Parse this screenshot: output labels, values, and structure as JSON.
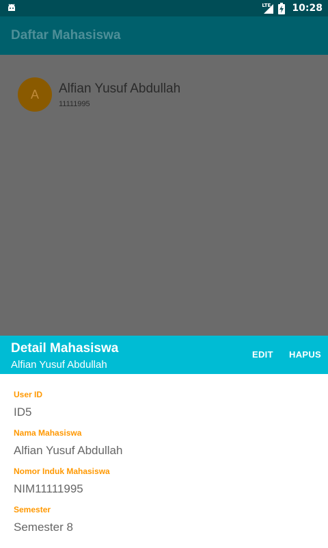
{
  "status_bar": {
    "network": "LTE",
    "time": "10:28"
  },
  "toolbar": {
    "title": "Daftar Mahasiswa"
  },
  "list": {
    "items": [
      {
        "avatar_letter": "A",
        "name": "Alfian Yusuf Abdullah",
        "nim": "11111995"
      }
    ]
  },
  "detail_sheet": {
    "title": "Detail Mahasiswa",
    "subtitle": "Alfian Yusuf Abdullah",
    "edit_label": "EDIT",
    "delete_label": "HAPUS",
    "fields": [
      {
        "label": "User ID",
        "value": "ID5"
      },
      {
        "label": "Nama Mahasiswa",
        "value": "Alfian Yusuf Abdullah"
      },
      {
        "label": "Nomor Induk Mahasiswa",
        "value": "NIM11111995"
      },
      {
        "label": "Semester",
        "value": "Semester 8"
      }
    ]
  },
  "colors": {
    "sheet_header": "#00bcd4",
    "field_label": "#ff9800",
    "toolbar_dimmed": "#00606c",
    "scrim": "#6b6b6b"
  },
  "icons": [
    "android-debug-icon",
    "lte-signal-icon",
    "battery-charging-icon"
  ]
}
